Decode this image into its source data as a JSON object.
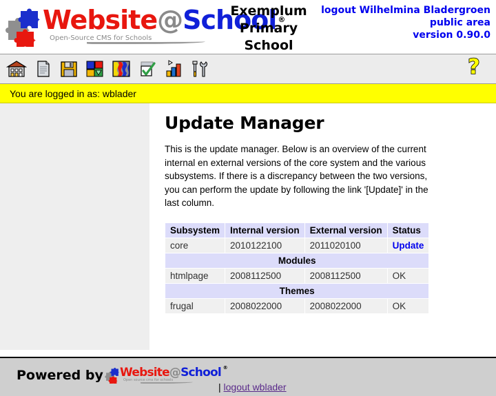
{
  "header": {
    "logo": {
      "word_part1": "Website",
      "word_at": "@",
      "word_part2": "School",
      "registered": "®",
      "tagline": "Open-Source CMS for Schools"
    },
    "school_name_line1": "Exemplum",
    "school_name_line2": "Primary School",
    "account": {
      "logout_user": "logout Wilhelmina Bladergroen",
      "area": "public area",
      "version": "version 0.90.0"
    }
  },
  "toolbar": {
    "items": [
      {
        "icon": "school-house-icon",
        "label": "School"
      },
      {
        "icon": "page-document-icon",
        "label": "Pages"
      },
      {
        "icon": "floppy-disk-icon",
        "label": "File manager"
      },
      {
        "icon": "puzzle-modules-icon",
        "label": "Modules"
      },
      {
        "icon": "themes-palette-icon",
        "label": "Themes"
      },
      {
        "icon": "checkbox-tick-icon",
        "label": "Tasks"
      },
      {
        "icon": "bar-chart-icon",
        "label": "Statistics"
      },
      {
        "icon": "tools-wrench-icon",
        "label": "Tools"
      }
    ],
    "help": {
      "icon": "help-question-icon",
      "label": "Help"
    }
  },
  "statusbar": {
    "text": "You are logged in as: wblader"
  },
  "main": {
    "title": "Update Manager",
    "intro": "This is the update manager. Below is an overview of the current internal en external versions of the core system and the various subsystems. If there is a discrepancy between the two versions, you can perform the update by following the link '[Update]' in the last column.",
    "table": {
      "columns": [
        "Subsystem",
        "Internal version",
        "External version",
        "Status"
      ],
      "rows": [
        {
          "type": "data",
          "cells": [
            "core",
            "2010122100",
            "2011020100",
            "Update"
          ],
          "status_is_link": true
        },
        {
          "type": "group",
          "label": "Modules"
        },
        {
          "type": "data",
          "cells": [
            "htmlpage",
            "2008112500",
            "2008112500",
            "OK"
          ],
          "status_is_link": false
        },
        {
          "type": "group",
          "label": "Themes"
        },
        {
          "type": "data",
          "cells": [
            "frugal",
            "2008022000",
            "2008022000",
            "OK"
          ],
          "status_is_link": false
        }
      ]
    }
  },
  "footer": {
    "powered_by": "Powered by",
    "logo": {
      "word_part1": "Website",
      "word_at": "@",
      "word_part2": "School",
      "registered": "®",
      "tagline": "Open source cms for schools"
    },
    "separator": "|",
    "logout_label": "logout wblader"
  },
  "colors": {
    "logo_red": "#e8170f",
    "logo_blue": "#1020d8",
    "logo_gray": "#8a8a8a",
    "link_blue": "#0000ee",
    "status_bg": "#ffff00",
    "table_header_bg": "#dcdcfa",
    "table_row_bg": "#f0f0f0",
    "sidebar_bg": "#eeeeee",
    "footer_bg": "#cfcfcf"
  }
}
